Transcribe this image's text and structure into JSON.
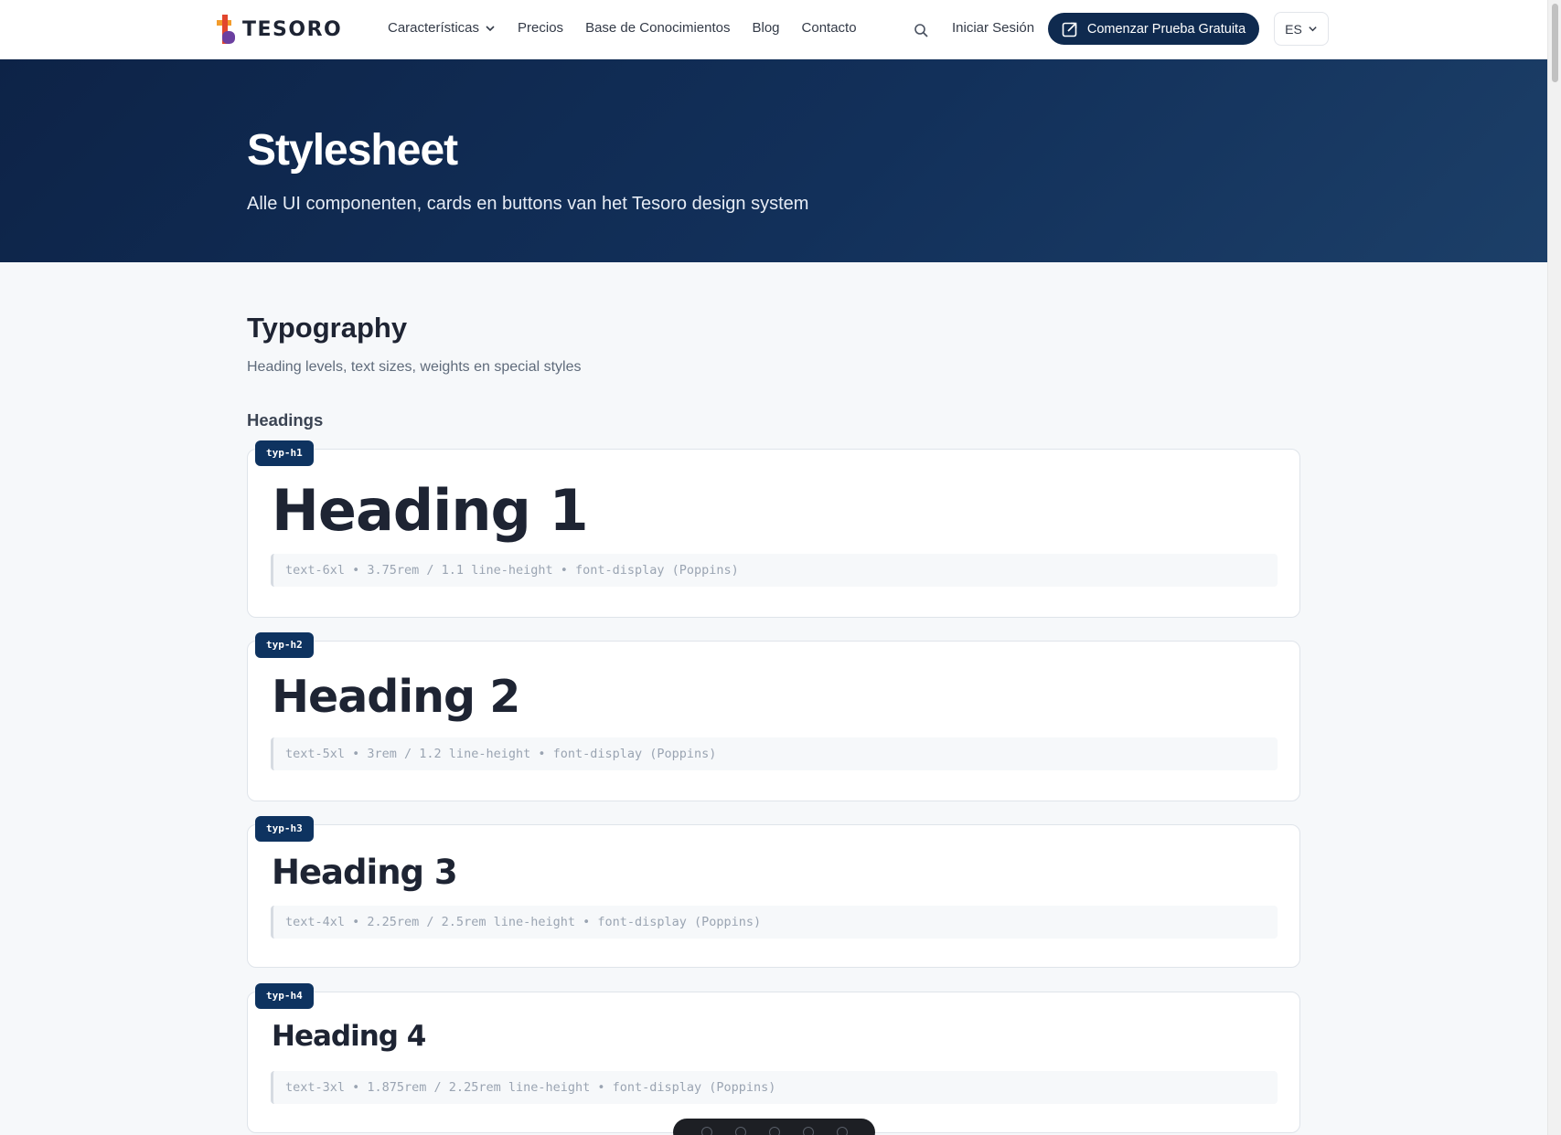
{
  "nav": {
    "logo": "TESORO",
    "links": [
      "Características",
      "Precios",
      "Base de Conocimientos",
      "Blog",
      "Contacto"
    ],
    "login": "Iniciar Sesión",
    "cta": "Comenzar Prueba Gratuita",
    "language": "ES"
  },
  "hero": {
    "title": "Stylesheet",
    "subtitle": "Alle UI componenten, cards en buttons van het Tesoro design system"
  },
  "section": {
    "title": "Typography",
    "description": "Heading levels, text sizes, weights en special styles",
    "subsection": "Headings"
  },
  "cards": [
    {
      "tag": "typ-h1",
      "heading": "Heading 1",
      "spec": "text-6xl • 3.75rem / 1.1 line-height • font-display (Poppins)"
    },
    {
      "tag": "typ-h2",
      "heading": "Heading 2",
      "spec": "text-5xl • 3rem / 1.2 line-height • font-display (Poppins)"
    },
    {
      "tag": "typ-h3",
      "heading": "Heading 3",
      "spec": "text-4xl • 2.25rem / 2.5rem line-height • font-display (Poppins)"
    },
    {
      "tag": "typ-h4",
      "heading": "Heading 4",
      "spec": "text-3xl • 1.875rem / 2.25rem line-height • font-display (Poppins)"
    }
  ],
  "colors": {
    "navy": "#0f2a4f",
    "tag": "#0e3360",
    "logo_orange": "#f39c2b",
    "logo_red": "#e2462d",
    "logo_purple": "#6b3fa0"
  }
}
